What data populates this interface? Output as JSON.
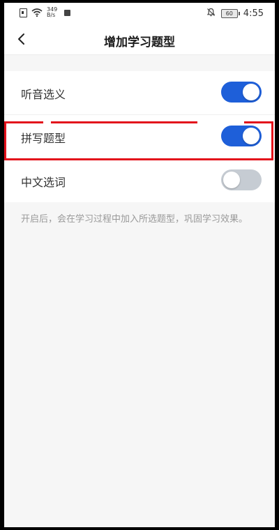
{
  "status_bar": {
    "net_speed_value": "349",
    "net_speed_unit": "B/s",
    "battery_level": "60",
    "time": "4:55"
  },
  "nav": {
    "title": "增加学习题型"
  },
  "settings": {
    "items": [
      {
        "label": "听音选义",
        "enabled": true
      },
      {
        "label": "拼写题型",
        "enabled": true
      },
      {
        "label": "中文选词",
        "enabled": false
      }
    ]
  },
  "hint": "开启后，会在学习过程中加入所选题型，巩固学习效果。",
  "colors": {
    "toggle_on": "#1e5fd9",
    "toggle_off": "#c6ccd3",
    "highlight": "#e3101b"
  },
  "icons": {
    "back": "chevron-left-icon",
    "sim": "sim-card-icon",
    "wifi": "wifi-icon",
    "mute": "bell-off-icon",
    "battery": "battery-icon"
  }
}
